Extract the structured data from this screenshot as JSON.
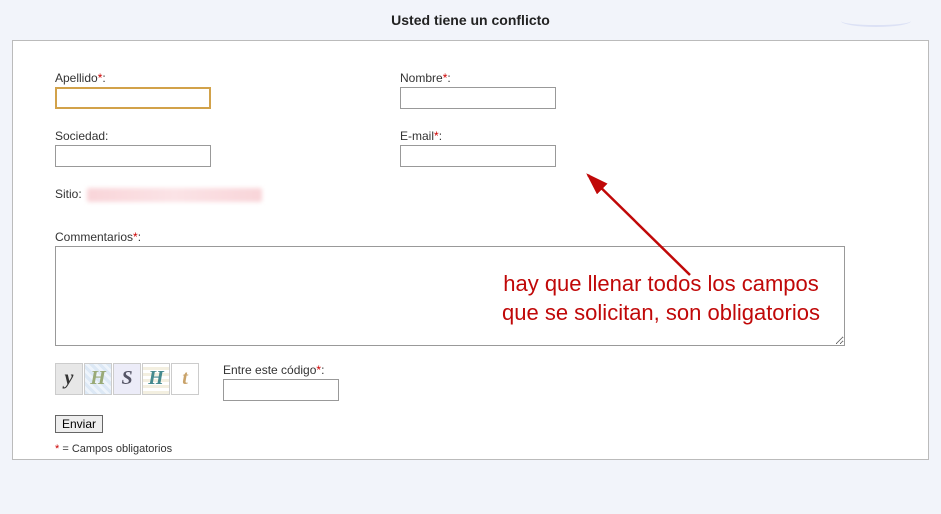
{
  "title": "Usted tiene un conflicto",
  "fields": {
    "apellido": {
      "label": "Apellido",
      "required": true,
      "value": ""
    },
    "nombre": {
      "label": "Nombre",
      "required": true,
      "value": ""
    },
    "sociedad": {
      "label": "Sociedad:",
      "required": false,
      "value": ""
    },
    "email": {
      "label": "E-mail",
      "required": true,
      "value": ""
    },
    "sitio": {
      "label": "Sitio:"
    },
    "commentarios": {
      "label": "Commentarios",
      "required": true,
      "value": ""
    },
    "captcha_code": {
      "label": "Entre este código",
      "required": true,
      "value": ""
    }
  },
  "captcha_letters": [
    "y",
    "H",
    "S",
    "H",
    "t"
  ],
  "submit_label": "Enviar",
  "required_marker": "*",
  "footnote_prefix": "* ",
  "footnote_text": "= Campos obligatorios",
  "annotation": {
    "text": "hay que llenar todos los campos que se solicitan, son obligatorios"
  }
}
